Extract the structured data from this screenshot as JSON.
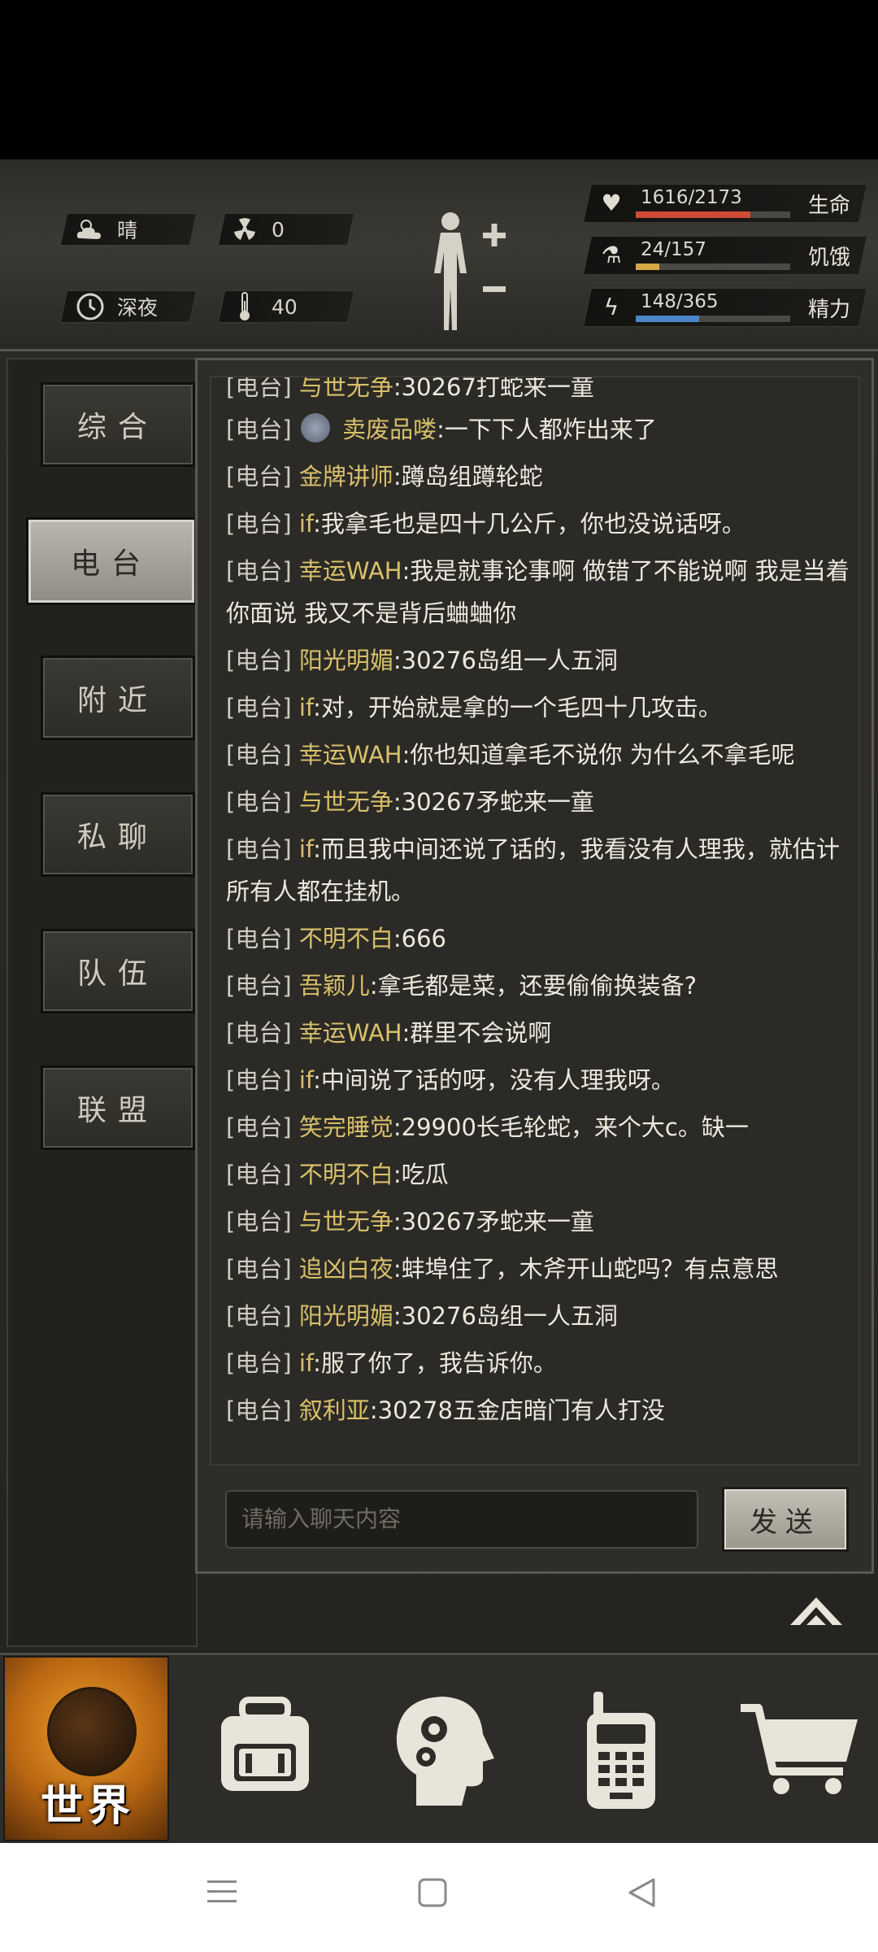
{
  "hud": {
    "weather": "晴",
    "radiation": "0",
    "time_of_day": "深夜",
    "temperature": "40",
    "stats": [
      {
        "label": "生命",
        "value": "1616/2173",
        "fill": 0.74,
        "color": "#d04a36",
        "icon": "heart-icon"
      },
      {
        "label": "饥饿",
        "value": "24/157",
        "fill": 0.15,
        "color": "#d4a845",
        "icon": "stomach-icon"
      },
      {
        "label": "精力",
        "value": "148/365",
        "fill": 0.41,
        "color": "#4a86c6",
        "icon": "energy-icon"
      }
    ]
  },
  "tabs": [
    {
      "label": "综合",
      "active": false
    },
    {
      "label": "电台",
      "active": true
    },
    {
      "label": "附近",
      "active": false
    },
    {
      "label": "私聊",
      "active": false
    },
    {
      "label": "队伍",
      "active": false
    },
    {
      "label": "联盟",
      "active": false
    }
  ],
  "chat": {
    "partial_top": {
      "tag": "[电台]",
      "name": "与世无争",
      "text": ":30267打蛇来一童"
    },
    "messages": [
      {
        "tag": "[电台]",
        "name": "卖废品喽",
        "text": ":一下下人都炸出来了",
        "avatar": true
      },
      {
        "tag": "[电台]",
        "name": "金牌讲师",
        "text": ":蹲岛组蹲轮蛇"
      },
      {
        "tag": "[电台]",
        "name": "if",
        "text": ":我拿毛也是四十几公斤，你也没说话呀。"
      },
      {
        "tag": "[电台]",
        "name": "幸运WAH",
        "text": ":我是就事论事啊 做错了不能说啊 我是当着你面说 我又不是背后蛐蛐你"
      },
      {
        "tag": "[电台]",
        "name": "阳光明媚",
        "text": ":30276岛组一人五洞"
      },
      {
        "tag": "[电台]",
        "name": "if",
        "text": ":对，开始就是拿的一个毛四十几攻击。"
      },
      {
        "tag": "[电台]",
        "name": "幸运WAH",
        "text": ":你也知道拿毛不说你 为什么不拿毛呢"
      },
      {
        "tag": "[电台]",
        "name": "与世无争",
        "text": ":30267矛蛇来一童"
      },
      {
        "tag": "[电台]",
        "name": "if",
        "text": ":而且我中间还说了话的，我看没有人理我，就估计所有人都在挂机。"
      },
      {
        "tag": "[电台]",
        "name": "不明不白",
        "text": ":666"
      },
      {
        "tag": "[电台]",
        "name": "吾颖儿",
        "text": ":拿毛都是菜，还要偷偷换装备?"
      },
      {
        "tag": "[电台]",
        "name": "幸运WAH",
        "text": ":群里不会说啊"
      },
      {
        "tag": "[电台]",
        "name": "if",
        "text": ":中间说了话的呀，没有人理我呀。"
      },
      {
        "tag": "[电台]",
        "name": "笑完睡觉",
        "text": ":29900长毛轮蛇，来个大c。缺一"
      },
      {
        "tag": "[电台]",
        "name": "不明不白",
        "text": ":吃瓜"
      },
      {
        "tag": "[电台]",
        "name": "与世无争",
        "text": ":30267矛蛇来一童"
      },
      {
        "tag": "[电台]",
        "name": "追凶白夜",
        "text": ":蚌埠住了，木斧开山蛇吗？有点意思"
      },
      {
        "tag": "[电台]",
        "name": "阳光明媚",
        "text": ":30276岛组一人五洞"
      },
      {
        "tag": "[电台]",
        "name": "if",
        "text": ":服了你了，我告诉你。"
      },
      {
        "tag": "[电台]",
        "name": "叙利亚",
        "text": ":30278五金店暗门有人打没"
      }
    ],
    "input_placeholder": "请输入聊天内容",
    "send_label": "发送"
  },
  "nav": {
    "world_label": "世界",
    "items": [
      "backpack-icon",
      "skills-head-icon",
      "radio-icon",
      "cart-icon"
    ]
  }
}
